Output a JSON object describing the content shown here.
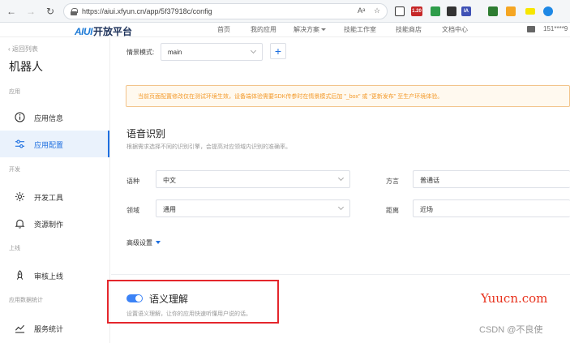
{
  "browser": {
    "url": "https://aiui.xfyun.cn/app/5f37918c/config",
    "reader_icon": "Aᵃ",
    "extension_badge": "1.20",
    "extension_ia": "IA"
  },
  "header": {
    "logo_mark": "AIUI",
    "logo_text": "开放平台",
    "nav": [
      "首页",
      "我的应用",
      "解决方案",
      "技能工作室",
      "技能商店",
      "文档中心"
    ],
    "user": "151****9"
  },
  "sidebar": {
    "back": "返回列表",
    "app_name": "机器人",
    "sections": {
      "app": "应用",
      "dev": "开发",
      "online": "上线",
      "stats": "应用数据统计"
    },
    "items": [
      {
        "label": "应用信息",
        "icon": "info-icon"
      },
      {
        "label": "应用配置",
        "icon": "sliders-icon",
        "active": true
      },
      {
        "label": "开发工具",
        "icon": "gear-icon"
      },
      {
        "label": "资源制作",
        "icon": "bell-icon"
      },
      {
        "label": "审核上线",
        "icon": "rocket-icon"
      },
      {
        "label": "服务统计",
        "icon": "chart-icon"
      }
    ]
  },
  "main": {
    "scene_label": "情景模式:",
    "scene_value": "main",
    "add_label": "+",
    "notice": "当前页面配置修改仅在测试环境生效，设备端体验需要SDK传参时在情景模式后加 \"_box\" 或 \"更新发布\" 至生产环境体验。",
    "speech": {
      "title": "语音识别",
      "desc": "根据需求选择不同的识别引擎，会提高对应领域内识别的准确率。",
      "language_label": "语种",
      "language_value": "中文",
      "dialect_label": "方言",
      "dialect_value": "普通话",
      "domain_label": "领域",
      "domain_value": "通用",
      "distance_label": "距离",
      "distance_value": "近场",
      "advanced": "高级设置"
    },
    "semantic": {
      "title": "语义理解",
      "desc": "设置语义理解，让你的应用快速听懂用户说的话。",
      "enabled": true
    }
  },
  "watermarks": {
    "site": "Yuucn.com",
    "csdn": "CSDN @不良使"
  },
  "colors": {
    "accent": "#1d6fe0",
    "warning": "#f39a2b",
    "highlight": "#e4262c"
  }
}
